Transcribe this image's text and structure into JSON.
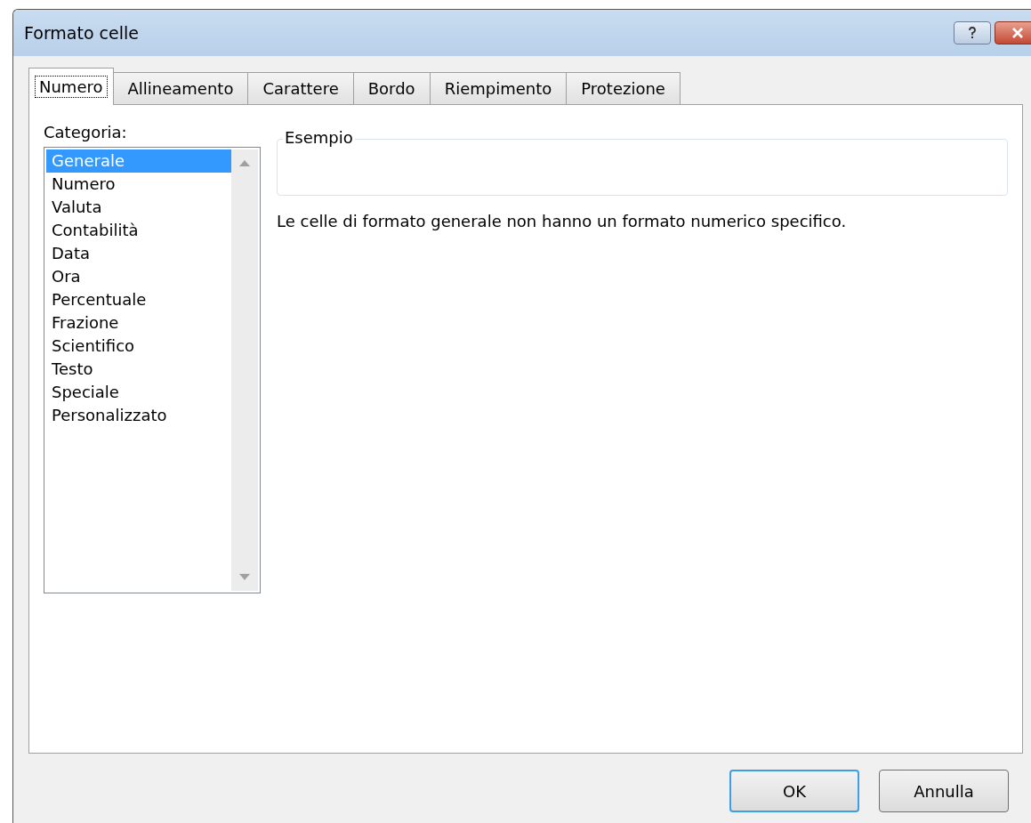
{
  "window": {
    "title": "Formato celle"
  },
  "tabs": [
    {
      "label": "Numero",
      "selected": true
    },
    {
      "label": "Allineamento",
      "selected": false
    },
    {
      "label": "Carattere",
      "selected": false
    },
    {
      "label": "Bordo",
      "selected": false
    },
    {
      "label": "Riempimento",
      "selected": false
    },
    {
      "label": "Protezione",
      "selected": false
    }
  ],
  "category": {
    "label": "Categoria:",
    "items": [
      {
        "label": "Generale",
        "selected": true
      },
      {
        "label": "Numero",
        "selected": false
      },
      {
        "label": "Valuta",
        "selected": false
      },
      {
        "label": "Contabilità",
        "selected": false
      },
      {
        "label": "Data",
        "selected": false
      },
      {
        "label": "Ora",
        "selected": false
      },
      {
        "label": "Percentuale",
        "selected": false
      },
      {
        "label": "Frazione",
        "selected": false
      },
      {
        "label": "Scientifico",
        "selected": false
      },
      {
        "label": "Testo",
        "selected": false
      },
      {
        "label": "Speciale",
        "selected": false
      },
      {
        "label": "Personalizzato",
        "selected": false
      }
    ]
  },
  "sample": {
    "label": "Esempio"
  },
  "description": "Le celle di formato generale non hanno un formato numerico specifico.",
  "buttons": [
    {
      "label": "OK",
      "default": true
    },
    {
      "label": "Annulla",
      "default": false
    }
  ]
}
